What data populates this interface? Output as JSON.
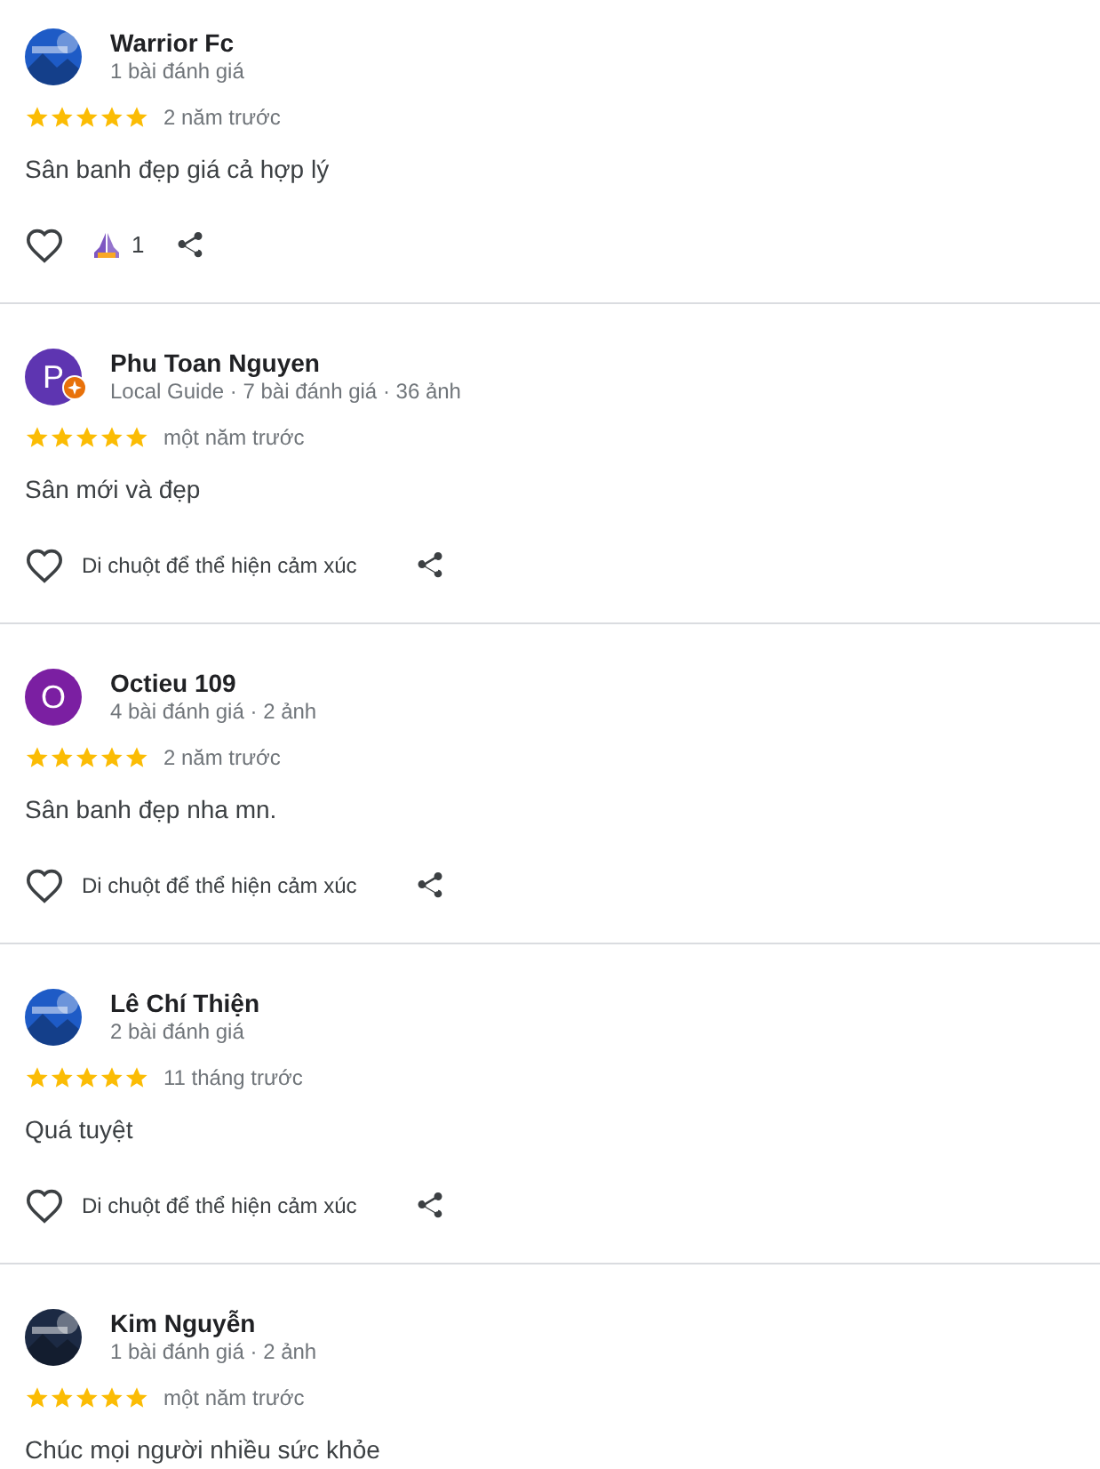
{
  "reviews": [
    {
      "name": "Warrior Fc",
      "meta": "1 bài đánh giá",
      "stars": 5,
      "time": "2 năm trước",
      "text": "Sân banh đẹp giá cả hợp lý",
      "actions": {
        "reaction_count": "1"
      }
    },
    {
      "name": "Phu Toan Nguyen",
      "meta": "Local Guide · 7 bài đánh giá · 36 ảnh",
      "avatar": {
        "kind": "letter",
        "letter": "P",
        "color": "#5e35b1",
        "local_guide": true
      },
      "stars": 5,
      "time": "một năm trước",
      "text": "Sân mới và đẹp",
      "actions": {
        "hint": "Di chuột để thể hiện cảm xúc"
      }
    },
    {
      "name": "Octieu 109",
      "meta": "4 bài đánh giá · 2 ảnh",
      "avatar": {
        "kind": "letter",
        "letter": "O",
        "color": "#7b1fa2"
      },
      "stars": 5,
      "time": "2 năm trước",
      "text": "Sân banh đẹp nha mn.",
      "actions": {
        "hint": "Di chuột để thể hiện cảm xúc"
      }
    },
    {
      "name": "Lê Chí Thiện",
      "meta": "2 bài đánh giá",
      "stars": 5,
      "time": "11 tháng trước",
      "text": "Quá tuyệt",
      "actions": {
        "hint": "Di chuột để thể hiện cảm xúc"
      }
    },
    {
      "name": "Kim Nguyễn",
      "meta": "1 bài đánh giá · 2 ảnh",
      "stars": 5,
      "time": "một năm trước",
      "text": "Chúc mọi người nhiều sức khỏe"
    }
  ]
}
